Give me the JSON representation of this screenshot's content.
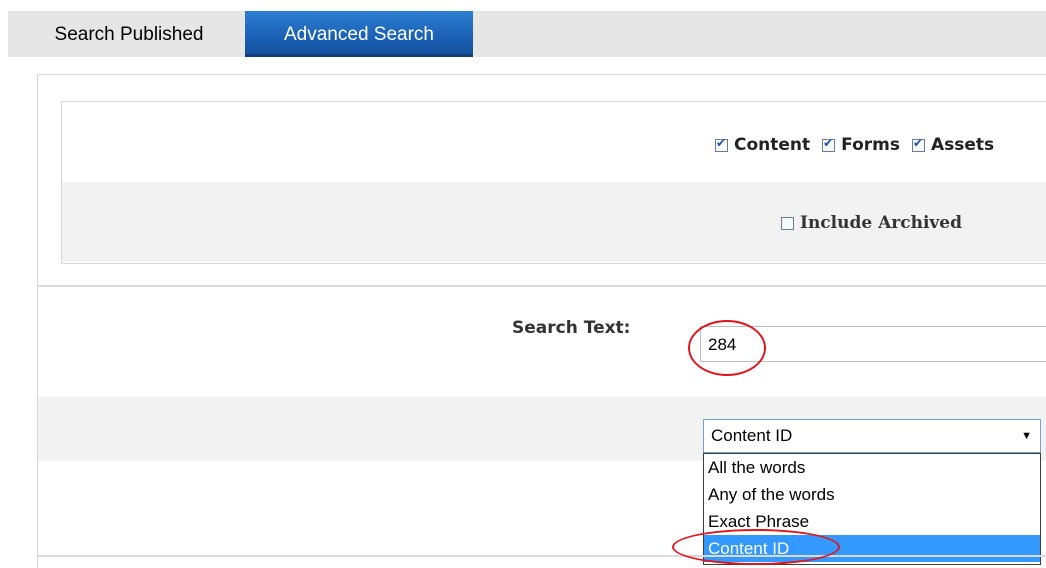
{
  "tabs": [
    {
      "label": "Search Published",
      "active": false
    },
    {
      "label": "Advanced Search",
      "active": true
    }
  ],
  "filters": {
    "content": {
      "label": "Content",
      "checked": true
    },
    "forms": {
      "label": "Forms",
      "checked": true
    },
    "assets": {
      "label": "Assets",
      "checked": true
    },
    "include_archived": {
      "label": "Include Archived",
      "checked": false
    }
  },
  "search": {
    "label": "Search Text:",
    "value": "284"
  },
  "search_type": {
    "selected": "Content ID",
    "options": [
      "All the words",
      "Any of the words",
      "Exact Phrase",
      "Content ID"
    ],
    "highlighted_index": 3
  },
  "colors": {
    "tab_active": "#1a5fb4",
    "annotation": "#e0151e",
    "option_highlight": "#3399ff"
  }
}
